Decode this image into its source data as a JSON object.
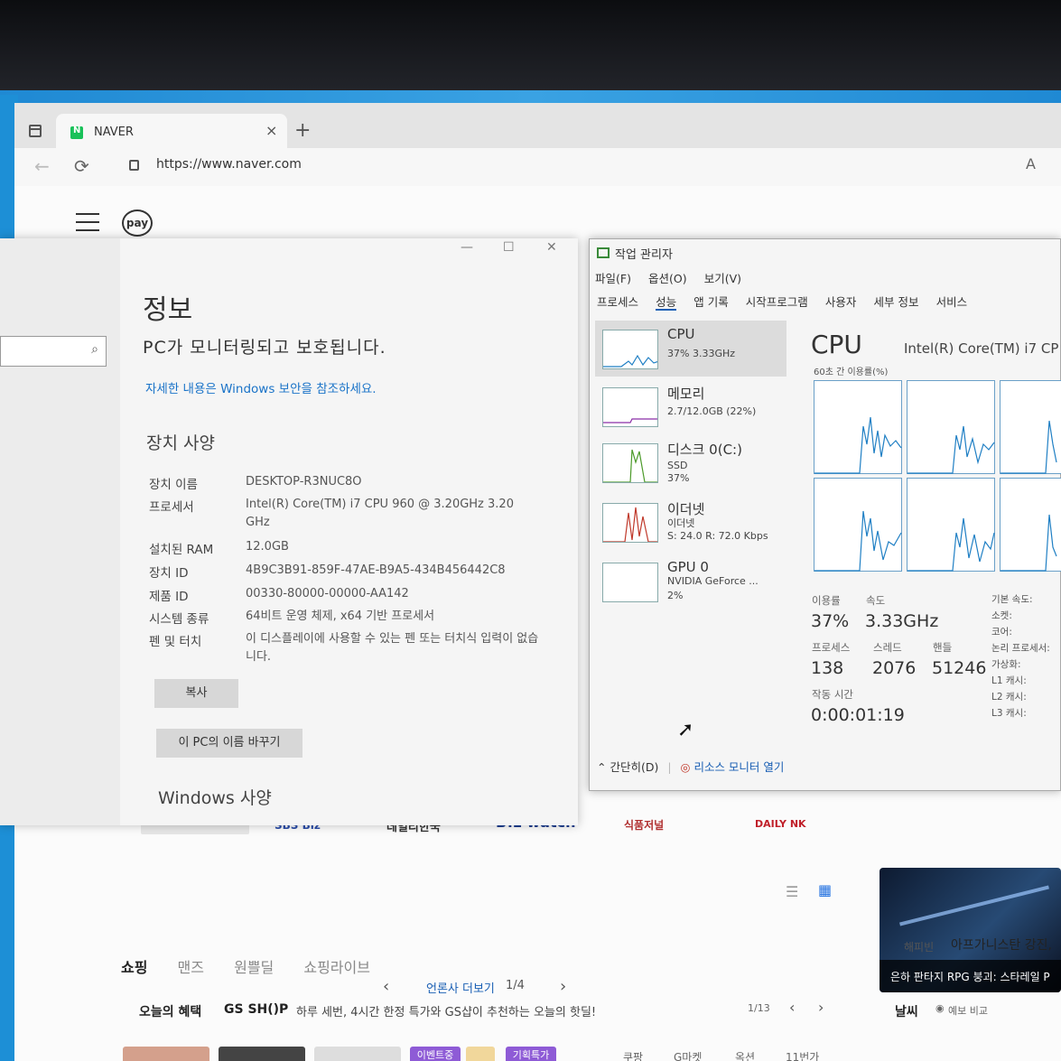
{
  "browser": {
    "tab_title": "NAVER",
    "tab_close": "×",
    "new_tab": "+",
    "url": "https://www.naver.com",
    "read_aloud": "A",
    "pay_label": "pay"
  },
  "naver": {
    "press_logos": [
      "SBS Biz",
      "데일리한국",
      "B!z watch",
      "식품저널",
      "DAILY NK"
    ],
    "press_more": "언론사 더보기",
    "press_page": "1/4",
    "shop_tabs": [
      "쇼핑",
      "맨즈",
      "원쁠딜",
      "쇼핑라이브"
    ],
    "benefit_label": "오늘의 혜택",
    "gsshop": "GS SH()P",
    "benefit_text": "하루 세번, 4시간 한정 특가와 GS샵이 추천하는 오늘의 핫딜!",
    "benefit_page": "1/13",
    "video_title": "은하 판타지 RPG 붕괴: 스타레일 P",
    "news_source": "해피빈",
    "news_title": "아프가니스탄 강진,",
    "weather_label": "날씨",
    "weather_compare": "예보 비교",
    "bottom_tags": [
      "이벤트중",
      "기획특가"
    ],
    "bottom_links": [
      "쿠팡",
      "G마켓",
      "옥션",
      "11번가"
    ]
  },
  "about": {
    "window_min": "—",
    "window_max": "☐",
    "window_close": "✕",
    "title": "정보",
    "protect_text": "PC가 모니터링되고 보호됩니다.",
    "security_link": "자세한 내용은 Windows 보안을 참조하세요.",
    "specs_heading": "장치 사양",
    "specs": [
      {
        "label": "장치 이름",
        "value": "DESKTOP-R3NUC8O"
      },
      {
        "label": "프로세서",
        "value": "Intel(R) Core(TM) i7 CPU         960   @ 3.20GHz   3.20 GHz"
      },
      {
        "label": "설치된 RAM",
        "value": "12.0GB"
      },
      {
        "label": "장치 ID",
        "value": "4B9C3B91-859F-47AE-B9A5-434B456442C8"
      },
      {
        "label": "제품 ID",
        "value": "00330-80000-00000-AA142"
      },
      {
        "label": "시스템 종류",
        "value": "64비트 운영 체제, x64 기반 프로세서"
      },
      {
        "label": "펜 및 터치",
        "value": "이 디스플레이에 사용할 수 있는 펜 또는 터치식 입력이 없습니다."
      }
    ],
    "copy_button": "복사",
    "rename_button": "이 PC의 이름 바꾸기",
    "windows_specs_heading": "Windows 사양"
  },
  "taskmanager": {
    "title": "작업 관리자",
    "menu": [
      "파일(F)",
      "옵션(O)",
      "보기(V)"
    ],
    "tabs": [
      "프로세스",
      "성능",
      "앱 기록",
      "시작프로그램",
      "사용자",
      "세부 정보",
      "서비스"
    ],
    "resources": [
      {
        "name": "CPU",
        "sub1": "37% 3.33GHz",
        "sub2": ""
      },
      {
        "name": "메모리",
        "sub1": "2.7/12.0GB (22%)",
        "sub2": ""
      },
      {
        "name": "디스크 0(C:)",
        "sub1": "SSD",
        "sub2": "37%"
      },
      {
        "name": "이더넷",
        "sub1": "이더넷",
        "sub2": "S: 24.0  R: 72.0 Kbps"
      },
      {
        "name": "GPU 0",
        "sub1": "NVIDIA GeForce ...",
        "sub2": "2%"
      }
    ],
    "cpu_heading": "CPU",
    "cpu_model": "Intel(R) Core(TM) i7 CP",
    "graph_label": "60초 간 이용률(%)",
    "utilization_label": "이용률",
    "utilization": "37%",
    "speed_label": "속도",
    "speed": "3.33GHz",
    "processes_label": "프로세스",
    "processes": "138",
    "threads_label": "스레드",
    "threads": "2076",
    "handles_label": "핸들",
    "handles": "51246",
    "uptime_label": "작동 시간",
    "uptime": "0:00:01:19",
    "spec_keys": [
      "기본 속도:",
      "소켓:",
      "코어:",
      "논리 프로세서:",
      "가상화:",
      "L1 캐시:",
      "L2 캐시:",
      "L3 캐시:"
    ],
    "fewer_details": "간단히(D)",
    "resource_monitor": "리소스 모니터 열기",
    "colors": {
      "cpu": "#1f7fc4",
      "memory": "#8b2ea6",
      "disk": "#4c9a2a",
      "ethernet": "#c0392b",
      "graph_grid": "#6aa0c8"
    }
  }
}
